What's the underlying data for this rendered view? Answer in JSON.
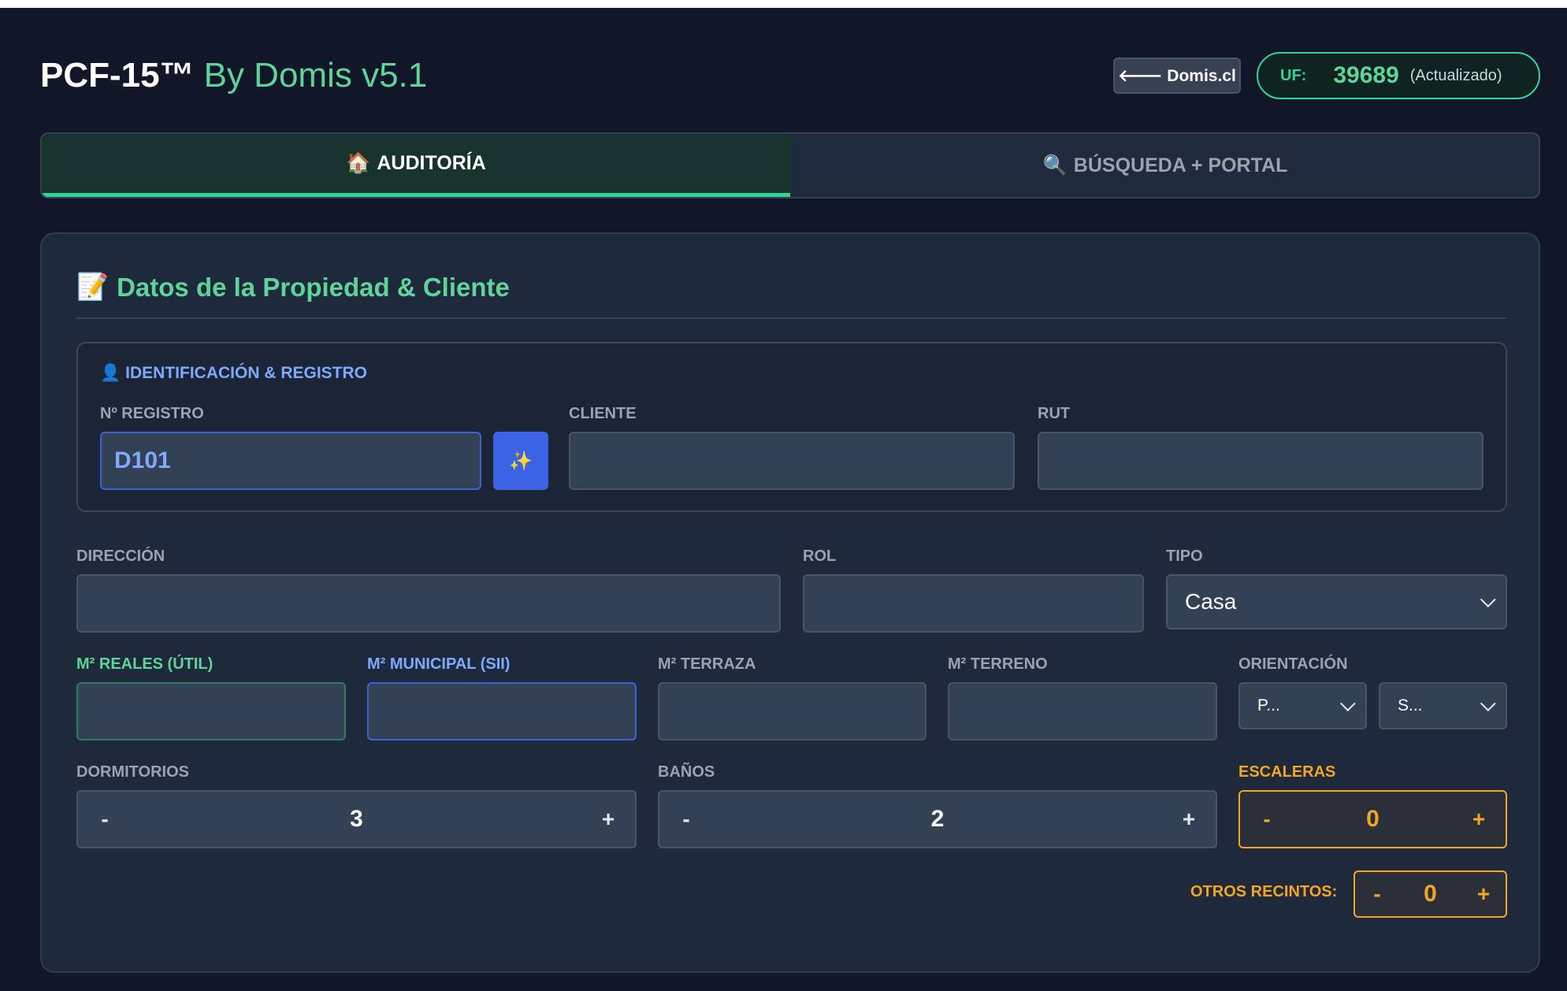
{
  "header": {
    "brand": "PCF-15™",
    "subtitle": "By Domis v5.1",
    "back_button": "🡐 Domis.cl",
    "uf_label": "UF:",
    "uf_value": "39689",
    "uf_status": "(Actualizado)"
  },
  "tabs": [
    {
      "icon": "🏠",
      "label": "AUDITORÍA",
      "active": true
    },
    {
      "icon": "🔍",
      "label": "BÚSQUEDA + PORTAL",
      "active": false
    }
  ],
  "card": {
    "icon": "📝",
    "title": "Datos de la Propiedad & Cliente",
    "section": {
      "icon": "👤",
      "title": "IDENTIFICACIÓN & REGISTRO",
      "registro_label": "Nº REGISTRO",
      "registro_value": "D101",
      "magic_icon": "✨",
      "cliente_label": "CLIENTE",
      "cliente_value": "",
      "rut_label": "RUT",
      "rut_value": ""
    },
    "direccion_label": "DIRECCIÓN",
    "direccion_value": "",
    "rol_label": "ROL",
    "rol_value": "",
    "tipo_label": "TIPO",
    "tipo_value": "Casa",
    "m2_reales_label": "M² REALES (ÚTIL)",
    "m2_municipal_label": "M² MUNICIPAL (SII)",
    "m2_terraza_label": "M² TERRAZA",
    "m2_terreno_label": "M² TERRENO",
    "orientacion_label": "ORIENTACIÓN",
    "orientacion_1": "P...",
    "orientacion_2": "S...",
    "dormitorios_label": "DORMITORIOS",
    "dormitorios_value": "3",
    "banos_label": "BAÑOS",
    "banos_value": "2",
    "escaleras_label": "ESCALERAS",
    "escaleras_value": "0",
    "otros_label": "OTROS RECINTOS:",
    "otros_value": "0",
    "minus": "-",
    "plus": "+"
  },
  "colors": {
    "background": "#111729",
    "accent_green": "#5fd49a",
    "accent_blue": "#7ea9ff",
    "accent_orange": "#f5a524"
  }
}
